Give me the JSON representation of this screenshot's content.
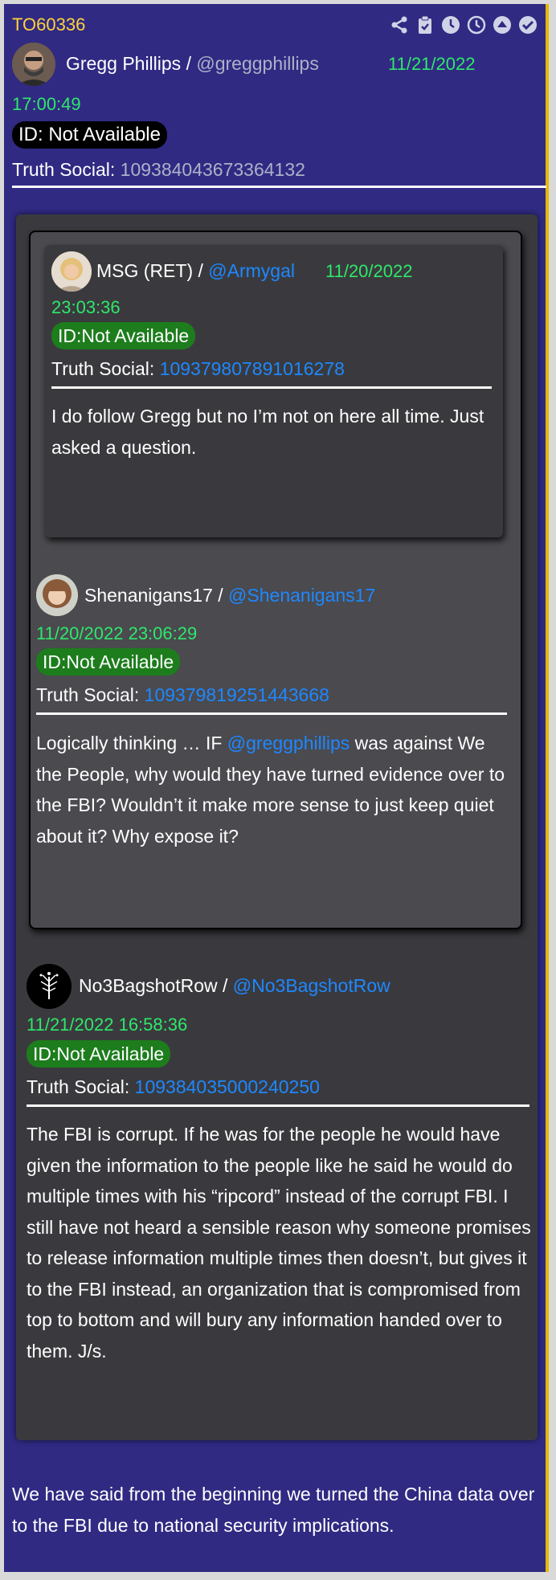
{
  "post_id": "TO60336",
  "toolbar": {
    "icons": [
      "share-icon",
      "clipboard-check-icon",
      "clock-filled-icon",
      "clock-outline-icon",
      "chevron-up-circle-icon",
      "check-circle-icon"
    ]
  },
  "author": {
    "name": "Gregg Phillips",
    "separator": " / ",
    "handle": "@greggphillips",
    "date": "11/21/2022",
    "time": "17:00:49",
    "id_label": "ID: Not Available",
    "ts_label": "Truth Social: ",
    "ts_id": "109384043673364132"
  },
  "quote_level2": {
    "name": "MSG (RET)",
    "separator": " / ",
    "handle": "@Armygal",
    "date": "11/20/2022",
    "time": "23:03:36",
    "id_label": "ID:Not Available",
    "ts_label": "Truth Social: ",
    "ts_id": "109379807891016278",
    "body": "I do follow Gregg but no I’m not on here all time. Just asked a question."
  },
  "quote_level1": {
    "name": "Shenanigans17",
    "separator": " / ",
    "handle": "@Shenanigans17",
    "datetime": "11/20/2022 23:06:29",
    "id_label": "ID:Not Available",
    "ts_label": "Truth Social: ",
    "ts_id": "109379819251443668",
    "body_pre": "Logically thinking … IF ",
    "body_mention": "@greggphillips",
    "body_post": "  was against We the People, why would they have turned evidence over to the FBI? Wouldn’t it make more sense to just keep quiet about it?  Why expose it?"
  },
  "quote_level0": {
    "name": "No3BagshotRow",
    "separator": " / ",
    "handle": "@No3BagshotRow",
    "datetime": "11/21/2022 16:58:36",
    "id_label": "ID:Not Available",
    "ts_label": "Truth Social: ",
    "ts_id": "109384035000240250",
    "body": "The FBI is corrupt. If he was for the people he would have given the information to the people like he said he would do multiple times with his “ripcord” instead of the corrupt FBI. I still have not heard a sensible reason why someone promises to release information multiple times then doesn’t, but gives it to the FBI instead, an organization that is compromised from top to bottom and will bury any information handed over to them. J/s."
  },
  "reply_text": "We have said from the beginning we turned the China data over to the FBI due to national security implications.",
  "colors": {
    "background": "#302a83",
    "green": "#2ee86a",
    "blue": "#1e88ff",
    "yellow": "#ffd23a",
    "accent_border": "#e6b800"
  }
}
